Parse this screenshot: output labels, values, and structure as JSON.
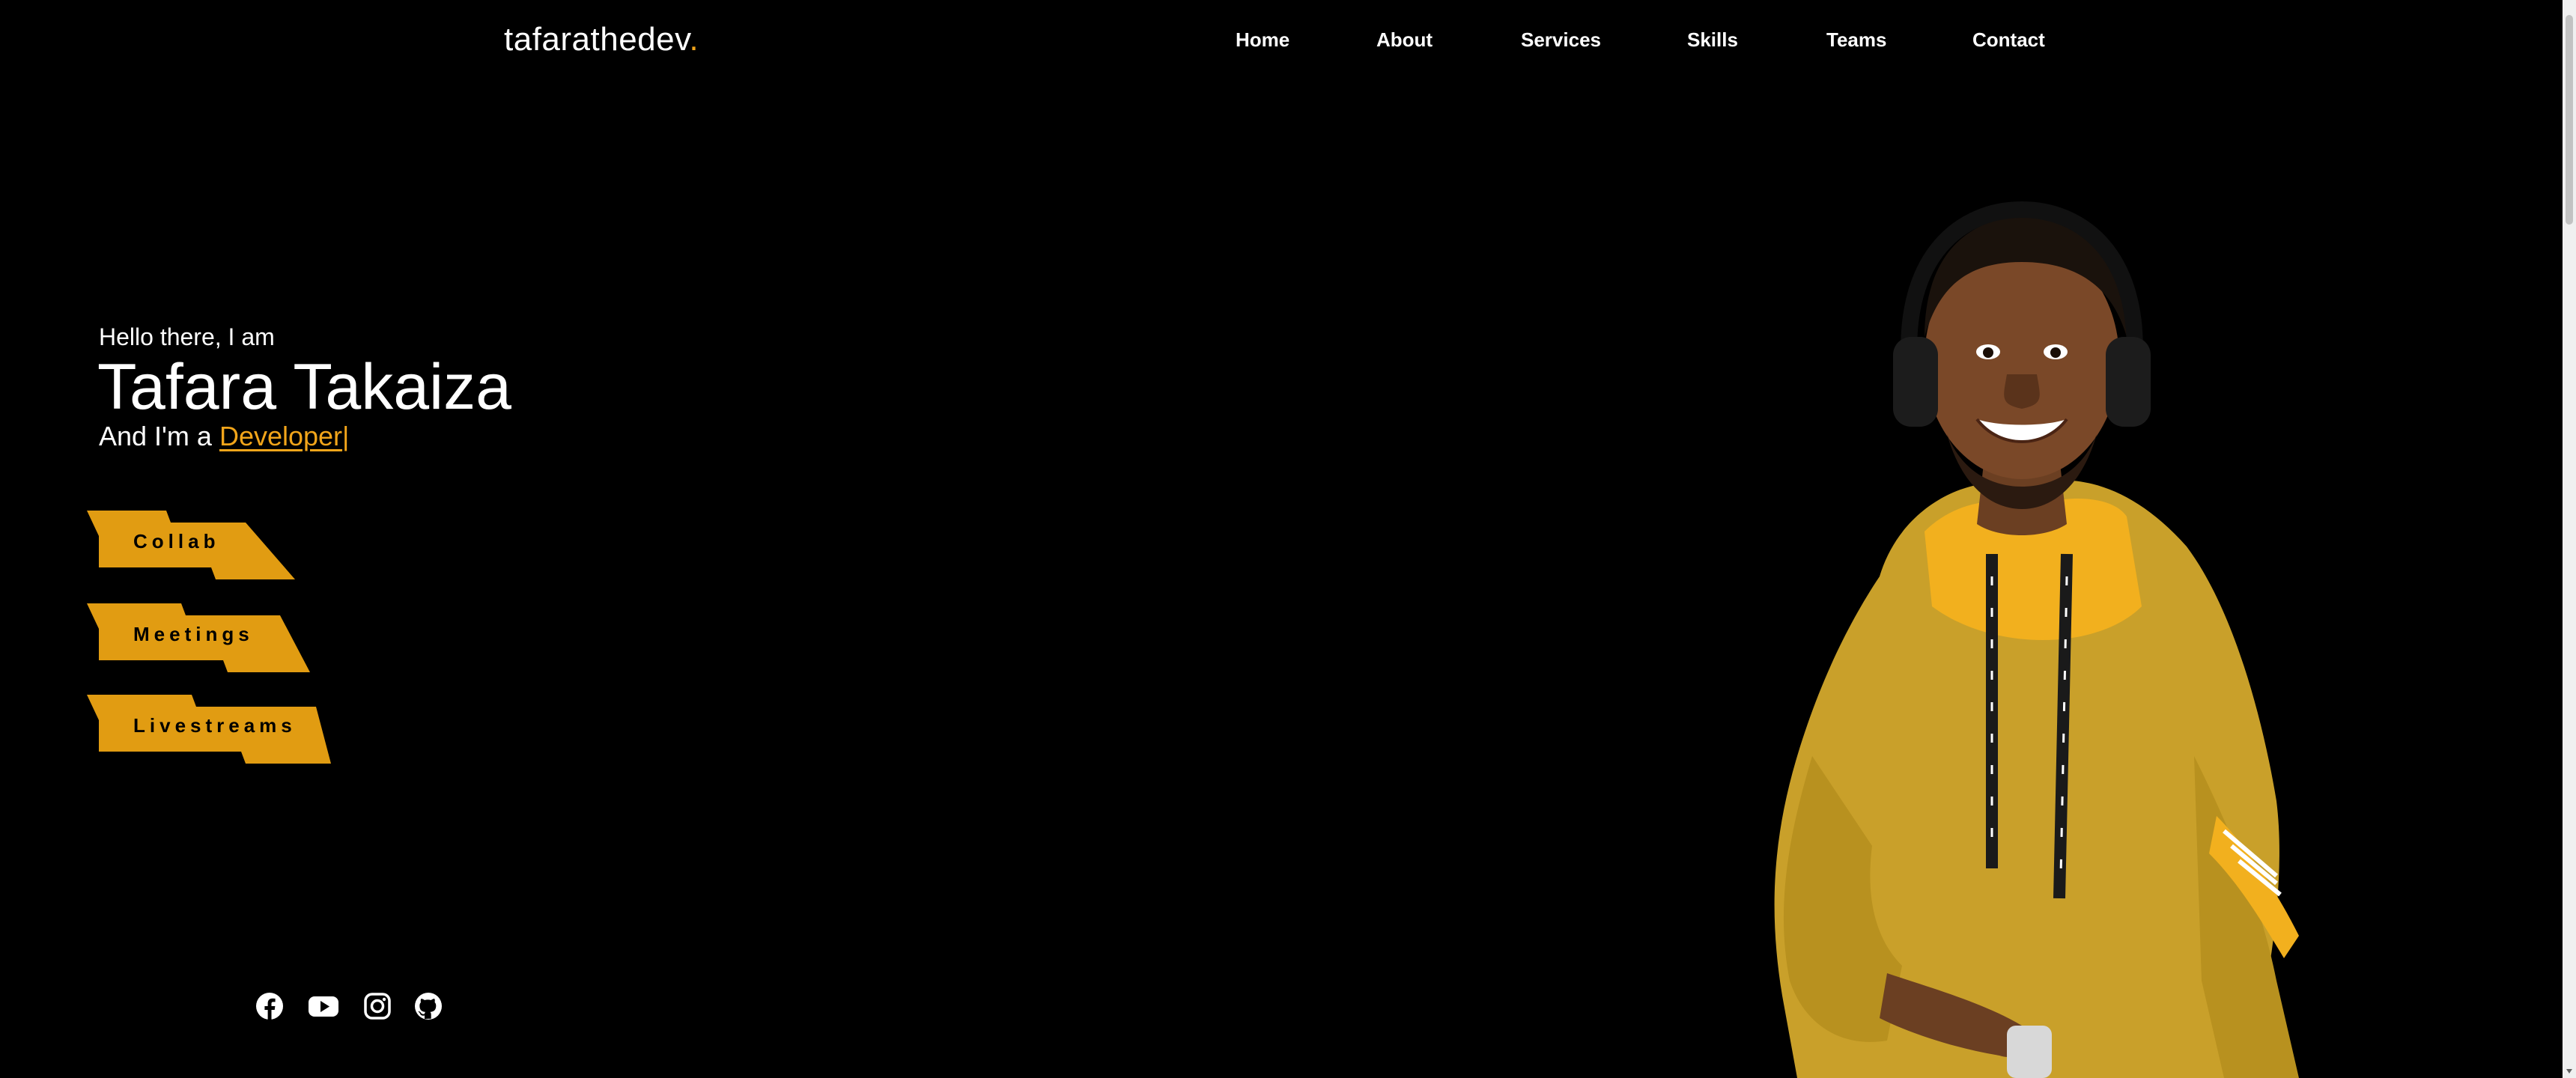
{
  "header": {
    "logo_text": "tafarathedev",
    "logo_dot": ".",
    "nav": [
      {
        "label": "Home"
      },
      {
        "label": "About"
      },
      {
        "label": "Services"
      },
      {
        "label": "Skills"
      },
      {
        "label": "Teams"
      },
      {
        "label": "Contact"
      }
    ]
  },
  "hero": {
    "greeting": "Hello there, I am",
    "name": "Tafara Takaiza",
    "role_prefix": "And I'm a ",
    "role": "Developer",
    "cursor": "|",
    "tags": [
      {
        "label": "Collab"
      },
      {
        "label": "Meetings"
      },
      {
        "label": "Livestreams"
      }
    ]
  },
  "social": {
    "icons": [
      "facebook-icon",
      "youtube-icon",
      "instagram-icon",
      "github-icon"
    ]
  },
  "colors": {
    "accent": "#f2a51a",
    "tag_fill": "#e19c12",
    "background": "#000000",
    "hoodie": "#c9a02a"
  }
}
